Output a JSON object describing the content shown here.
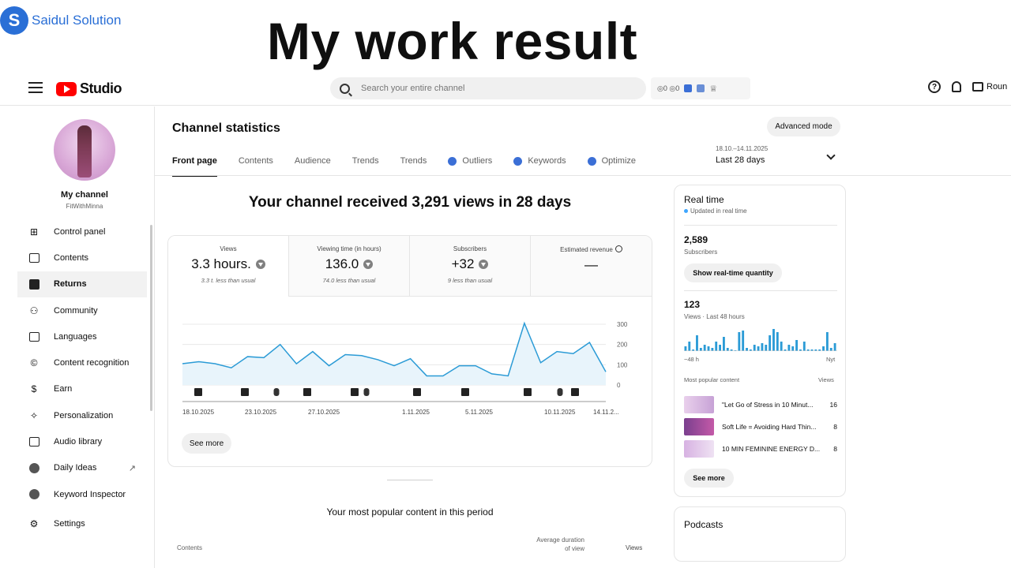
{
  "banner": {
    "brand_logo_letter": "S",
    "brand_name": "Saidul Solution",
    "headline": "My work result"
  },
  "topbar": {
    "logo_text": "Studio",
    "search_placeholder": "Search your entire channel",
    "ext_text": "◎0 ◎0",
    "help_icon_text": "?",
    "create_label": "Roun"
  },
  "sidebar": {
    "channel_name": "My channel",
    "channel_handle": "FitWithMinna",
    "items": [
      {
        "label": "Control panel",
        "icon": "dashboard-icon"
      },
      {
        "label": "Contents",
        "icon": "content-icon"
      },
      {
        "label": "Returns",
        "icon": "analytics-icon"
      },
      {
        "label": "Community",
        "icon": "community-icon"
      },
      {
        "label": "Languages",
        "icon": "subtitles-icon"
      },
      {
        "label": "Content recognition",
        "icon": "copyright-icon"
      },
      {
        "label": "Earn",
        "icon": "monetization-icon"
      },
      {
        "label": "Personalization",
        "icon": "customization-icon"
      },
      {
        "label": "Audio library",
        "icon": "audio-library-icon"
      },
      {
        "label": "Daily Ideas",
        "icon": "extension-icon"
      },
      {
        "label": "Keyword Inspector",
        "icon": "extension-icon"
      },
      {
        "label": "Settings",
        "icon": "settings-icon"
      }
    ],
    "external_link_glyph": "↗"
  },
  "main": {
    "title": "Channel statistics",
    "advanced_mode": "Advanced mode",
    "tabs": [
      "Front page",
      "Contents",
      "Audience",
      "Trends",
      "Trends",
      "Outliers",
      "Keywords",
      "Optimize"
    ],
    "date_range_small": "18.10.–14.11.2025",
    "date_range_label": "Last 28 days",
    "views_headline": "Your channel received 3,291 views in 28 days",
    "stats": [
      {
        "label": "Views",
        "value": "3.3 hours.",
        "sub": "3.3 t. less than usual"
      },
      {
        "label": "Viewing time (in hours)",
        "value": "136.0",
        "sub": "74.0 less than usual"
      },
      {
        "label": "Subscribers",
        "value": "+32",
        "sub": "9 less than usual"
      },
      {
        "label": "Estimated revenue",
        "value": "—",
        "sub": ""
      }
    ],
    "see_more": "See more",
    "popular_title": "Your most popular content in this period",
    "col_contents": "Contents",
    "col_avg_line1": "Average duration",
    "col_avg_line2": "of view",
    "col_views": "Views"
  },
  "chart_data": {
    "type": "line",
    "x_tick_labels": [
      "18.10.2025",
      "23.10.2025",
      "27.10.2025",
      "1.11.2025",
      "5.11.2025",
      "10.11.2025",
      "14.11.2..."
    ],
    "y_ticks": [
      0,
      100,
      200,
      300
    ],
    "ylim": [
      0,
      300
    ],
    "series": [
      {
        "values": [
          105,
          115,
          105,
          85,
          140,
          135,
          200,
          105,
          165,
          95,
          150,
          145,
          125,
          95,
          130,
          45,
          45,
          95,
          95,
          55,
          45,
          305,
          110,
          165,
          155,
          210,
          65
        ]
      }
    ],
    "line_color": "#2b9bd6",
    "fill_color": "#e8f4fb",
    "marker_tracks": [
      "video",
      "video",
      "short",
      "video",
      "video",
      "short",
      "video",
      "video",
      "video",
      "short",
      "video"
    ]
  },
  "realtime": {
    "title": "Real time",
    "subtitle": "Updated in real time",
    "subscribers": "2,589",
    "subscribers_label": "Subscribers",
    "show_realtime_btn": "Show real-time quantity",
    "views": "123",
    "views_label": "Views · Last 48 hours",
    "axis_left": "−48 h",
    "axis_right": "Nyt",
    "bars": [
      3,
      6,
      1,
      10,
      2,
      4,
      3,
      2,
      6,
      4,
      9,
      2,
      1,
      0,
      12,
      13,
      2,
      1,
      4,
      3,
      5,
      4,
      10,
      14,
      12,
      6,
      1,
      4,
      3,
      7,
      1,
      6,
      1,
      1,
      1,
      1,
      3,
      12,
      2,
      5
    ],
    "most_popular_header": "Most popular content",
    "views_header": "Views",
    "popular": [
      {
        "title": "\"Let Go of Stress in 10 Minut...",
        "views": "16"
      },
      {
        "title": "Soft Life = Avoiding Hard Thin...",
        "views": "8"
      },
      {
        "title": "10 MIN FEMININE ENERGY D...",
        "views": "8"
      }
    ],
    "see_more": "See more"
  },
  "podcasts": {
    "title": "Podcasts"
  }
}
